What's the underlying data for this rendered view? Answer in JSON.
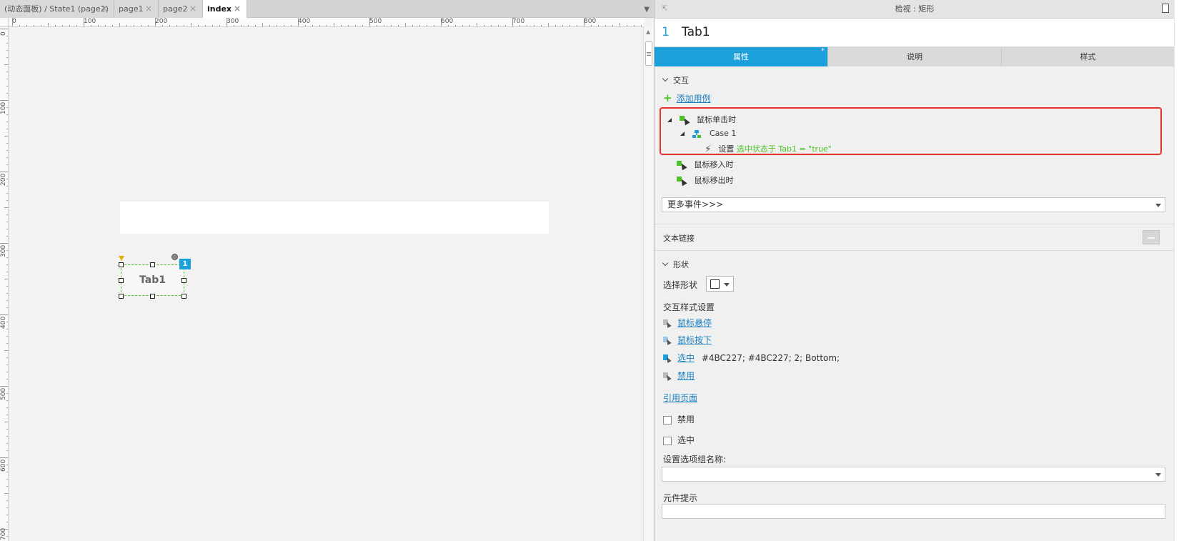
{
  "document_tabs": [
    {
      "label": "(动态面板) / State1 (page2)",
      "active": false
    },
    {
      "label": "page1",
      "active": false
    },
    {
      "label": "page2",
      "active": false
    },
    {
      "label": "index",
      "active": true
    }
  ],
  "close_glyph": "×",
  "ruler": {
    "top_labels": [
      "0",
      "100",
      "200",
      "300",
      "400",
      "500",
      "600",
      "700",
      "800"
    ],
    "left_labels": [
      "0",
      "100",
      "200",
      "300",
      "400",
      "500",
      "600",
      "700"
    ]
  },
  "canvas": {
    "widget_label": "Tab1",
    "widget_badge": "1"
  },
  "inspector": {
    "header_title": "检视 : 矩形",
    "widget_number": "1",
    "widget_name": "Tab1",
    "tabs": [
      {
        "label": "属性",
        "active": true,
        "marker": "*"
      },
      {
        "label": "说明",
        "active": false,
        "marker": ""
      },
      {
        "label": "样式",
        "active": false,
        "marker": ""
      }
    ],
    "interaction": {
      "section_title": "交互",
      "add_case_label": "添加用例",
      "events": {
        "onclick": "鼠标单击时",
        "case_name": "Case 1",
        "action_prefix": "设置",
        "action_detail": "选中状态于 Tab1 = \"true\"",
        "onmouseenter": "鼠标移入时",
        "onmouseout": "鼠标移出时"
      },
      "more_events": "更多事件>>>"
    },
    "text_link_label": "文本链接",
    "shape": {
      "section_title": "形状",
      "select_shape_label": "选择形状",
      "interaction_styles_title": "交互样式设置",
      "styles": {
        "hover": "鼠标悬停",
        "mousedown": "鼠标按下",
        "selected": "选中",
        "selected_value": "#4BC227; #4BC227; 2; Bottom;",
        "disabled": "禁用"
      },
      "reference_page": "引用页面",
      "checkbox_disabled": "禁用",
      "checkbox_selected": "选中",
      "group_name_label": "设置选项组名称:",
      "group_name_value": "",
      "tooltip_label": "元件提示",
      "tooltip_value": ""
    }
  },
  "colors": {
    "accent": "#1ca0dc",
    "selection_green": "#4BC227",
    "highlight_red": "#e8322c"
  },
  "icons": [
    "close-icon",
    "dropdown-arrow-icon",
    "pin-icon",
    "page-icon",
    "plus-icon",
    "event-cursor-icon",
    "case-icon",
    "lightning-icon",
    "cursor-style-icon",
    "chevron-down-icon"
  ]
}
